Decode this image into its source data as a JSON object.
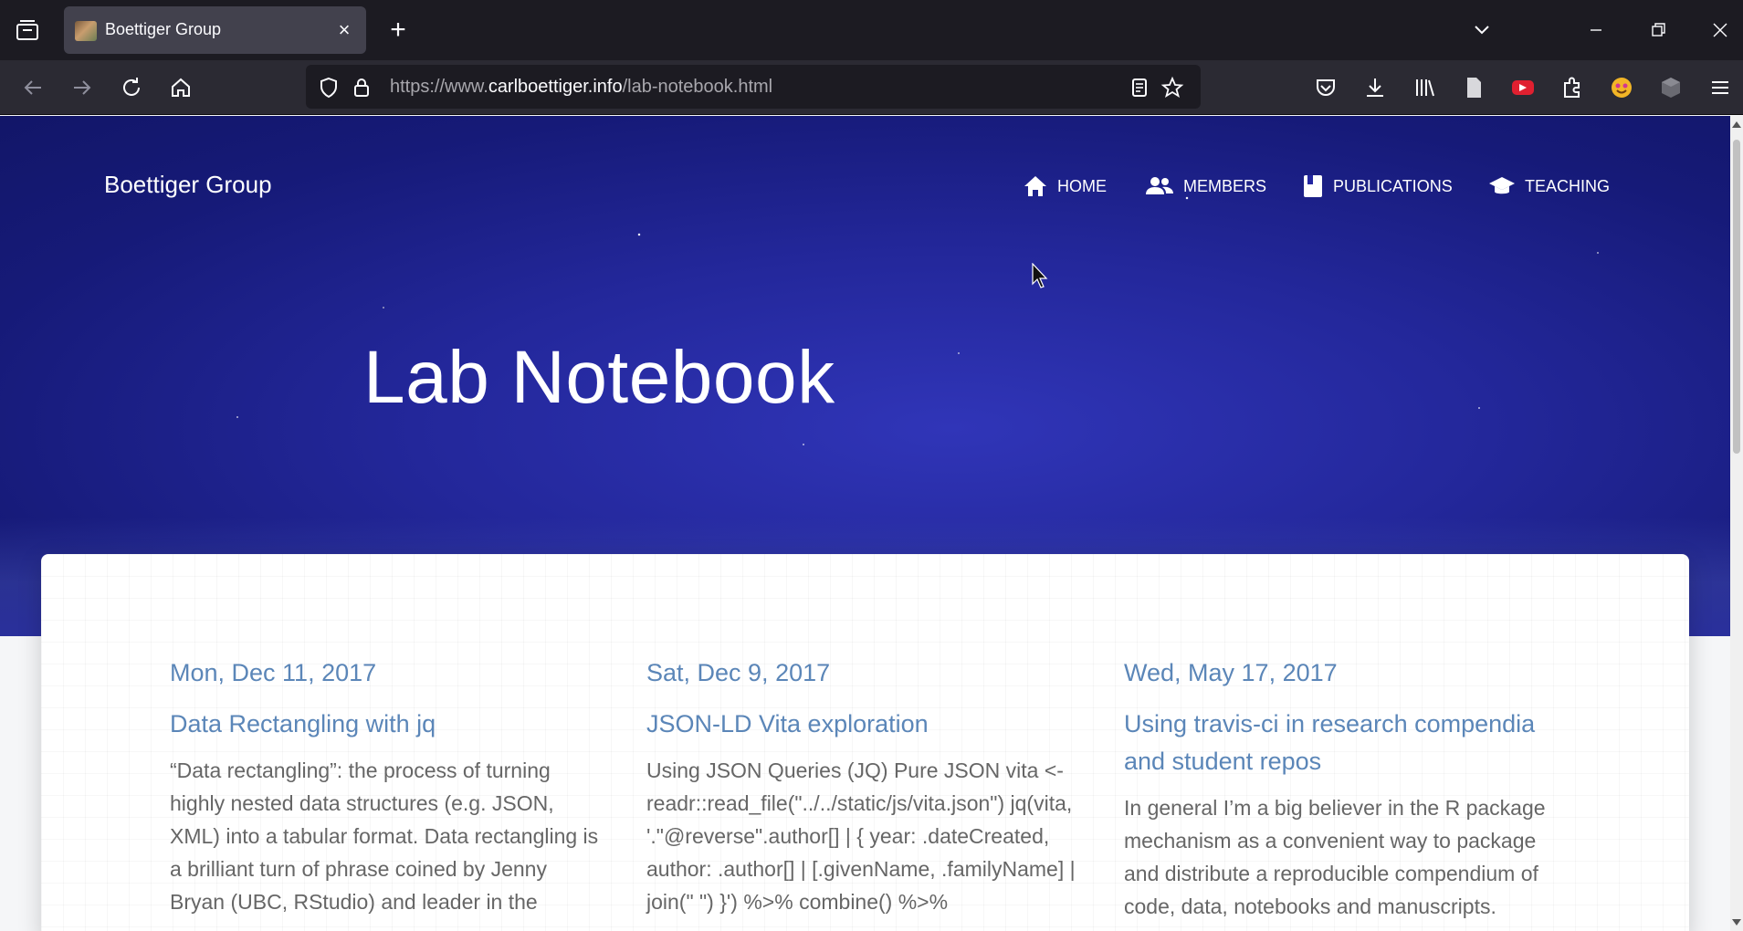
{
  "browser": {
    "tab": {
      "title": "Boettiger Group",
      "close_icon": "×"
    },
    "new_tab_icon": "+",
    "url": {
      "prefix": "https://www.",
      "host": "carlboettiger.info",
      "path": "/lab-notebook.html"
    },
    "window_controls": {
      "minimize": "—",
      "maximize": "❐",
      "close": "✕"
    }
  },
  "site": {
    "brand": "Boettiger Group",
    "nav": [
      {
        "label": "HOME",
        "icon": "home-icon"
      },
      {
        "label": "MEMBERS",
        "icon": "people-icon"
      },
      {
        "label": "PUBLICATIONS",
        "icon": "book-icon"
      },
      {
        "label": "TEACHING",
        "icon": "graduation-cap-icon"
      }
    ],
    "hero_title": "Lab Notebook"
  },
  "posts": [
    {
      "date": "Mon, Dec 11, 2017",
      "title": "Data Rectangling with jq",
      "excerpt": "“Data rectangling”: the process of turning highly nested data structures (e.g. JSON, XML) into a tabular format. Data rectangling is a brilliant turn of phrase coined by Jenny Bryan (UBC, RStudio) and leader in the"
    },
    {
      "date": "Sat, Dec 9, 2017",
      "title": "JSON-LD Vita exploration",
      "excerpt": "Using JSON Queries (JQ) Pure JSON vita <- readr::read_file(\"../../static/js/vita.json\") jq(vita, '.\"@reverse\".author[] | { year: .dateCreated, author: .author[] | [.givenName, .familyName] | join(\" \") }') %>% combine() %>%"
    },
    {
      "date": "Wed, May 17, 2017",
      "title": "Using travis-ci in research compendia and student repos",
      "excerpt": "In general I’m a big believer in the R package mechanism as a convenient way to package and distribute a reproducible compendium of code, data, notebooks and manuscripts."
    }
  ],
  "colors": {
    "link": "#5b86b8",
    "hero": "#23279a",
    "chrome": "#1c1b22"
  }
}
